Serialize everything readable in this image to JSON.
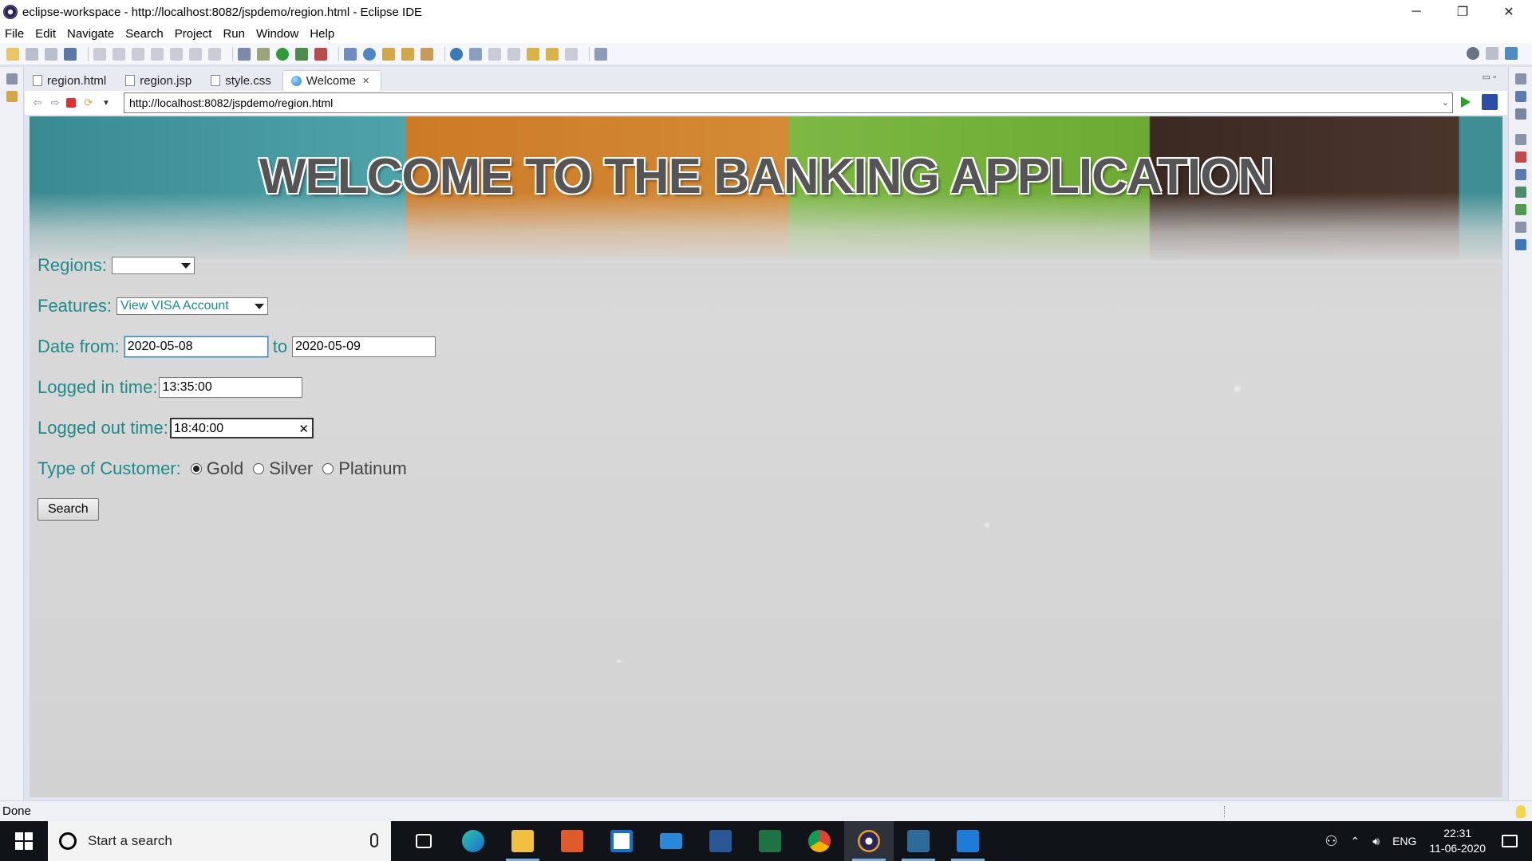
{
  "window": {
    "title": "eclipse-workspace - http://localhost:8082/jspdemo/region.html - Eclipse IDE",
    "minimize": "─",
    "maximize": "❐",
    "close": "✕"
  },
  "menu": [
    "File",
    "Edit",
    "Navigate",
    "Search",
    "Project",
    "Run",
    "Window",
    "Help"
  ],
  "tabs": [
    {
      "label": "region.html",
      "icon": "html-file-icon"
    },
    {
      "label": "region.jsp",
      "icon": "jsp-file-icon"
    },
    {
      "label": "style.css",
      "icon": "css-file-icon"
    },
    {
      "label": "Welcome",
      "icon": "globe-icon",
      "active": true
    }
  ],
  "browser": {
    "url": "http://localhost:8082/jspdemo/region.html"
  },
  "page": {
    "banner_title": "WELCOME TO THE BANKING APPLICATION",
    "regions_label": "Regions:",
    "regions_value": "",
    "features_label": "Features:",
    "features_value": "View VISA Account",
    "date_from_label": "Date from:",
    "date_from_value": "2020-05-08",
    "date_to_label": "to",
    "date_to_value": "2020-05-09",
    "logged_in_label": "Logged in time:",
    "logged_in_value": "13:35:00",
    "logged_out_label": "Logged out time:",
    "logged_out_value": "18:40:00",
    "customer_type_label": "Type of Customer:",
    "customer_types": [
      "Gold",
      "Silver",
      "Platinum"
    ],
    "customer_type_selected": "Gold",
    "search_button": "Search"
  },
  "status": {
    "text": "Done"
  },
  "taskbar": {
    "search_placeholder": "Start a search",
    "apps": [
      "task-view",
      "edge",
      "file-explorer",
      "office",
      "store",
      "mail",
      "word",
      "excel",
      "chrome",
      "eclipse",
      "mysql-workbench",
      "photos"
    ],
    "active_app": "eclipse",
    "lang": "ENG",
    "time": "22:31",
    "date": "11-06-2020"
  },
  "colors": {
    "label_teal": "#1f8a8a",
    "banner_teal": "#4ea3a8",
    "banner_orange": "#d48a35",
    "banner_green": "#7cb843",
    "banner_brown": "#4a352b"
  }
}
